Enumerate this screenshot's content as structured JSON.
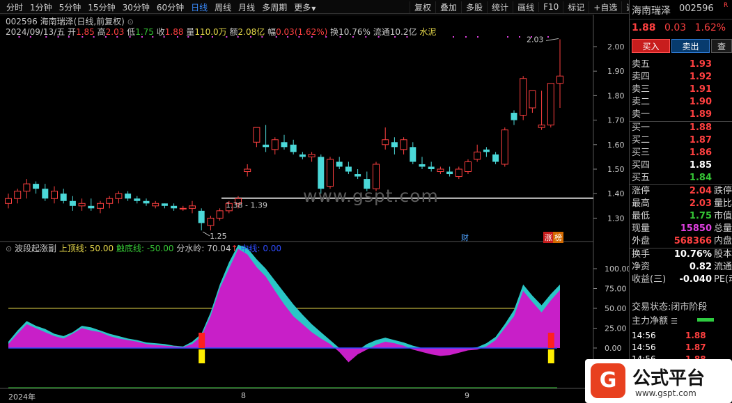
{
  "toolbar": {
    "periods": [
      {
        "label": "分时",
        "active": false
      },
      {
        "label": "1分钟",
        "active": false
      },
      {
        "label": "5分钟",
        "active": false
      },
      {
        "label": "15分钟",
        "active": false
      },
      {
        "label": "30分钟",
        "active": false
      },
      {
        "label": "60分钟",
        "active": false
      },
      {
        "label": "日线",
        "active": true
      },
      {
        "label": "周线",
        "active": false
      },
      {
        "label": "月线",
        "active": false
      },
      {
        "label": "多周期",
        "active": false
      }
    ],
    "more_label": "更多",
    "tools": [
      "复权",
      "叠加",
      "多股",
      "统计",
      "画线",
      "F10",
      "标记",
      "+自选",
      "返回"
    ]
  },
  "chart_header": {
    "code": "002596",
    "name": "海南瑞泽",
    "mode": "(日线,前复权)",
    "date": "2024/09/13/五",
    "open_label": "开",
    "open": "1.85",
    "high_label": "高",
    "high": "2.03",
    "low_label": "低",
    "low": "1.75",
    "close_label": "收",
    "close": "1.88",
    "vol_label": "量",
    "vol": "110.0万",
    "amount_label": "额",
    "amount": "2.08亿",
    "range_label": "幅",
    "range": "0.03(1.62%)",
    "turnover_label": "换",
    "turnover": "10.76%",
    "float_label": "流通",
    "float": "10.2亿",
    "sector": "水泥"
  },
  "annotations": {
    "high_mark": "2.03",
    "low_mark": "1.25",
    "range_mark": "1.38 - 1.39",
    "watermark": "www.gspt.com",
    "badge_cai": "财",
    "badge_zhang": "涨",
    "badge_bang": "榜"
  },
  "indicator": {
    "name": "波段起涨副",
    "top_label": "上顶线:",
    "top_value": "50.00",
    "bottom_label": "触底线:",
    "bottom_value": "-50.00",
    "split_label": "分水岭:",
    "split_value": "70.04",
    "mid_label": "中线:",
    "mid_value": "0.00"
  },
  "x_axis": {
    "year": "2024年",
    "m8": "8",
    "m9": "9"
  },
  "chart_data": [
    {
      "type": "candlestick",
      "title": "002596 海南瑞泽(日线,前复权)",
      "y_ticks": [
        2.0,
        1.9,
        1.8,
        1.7,
        1.6,
        1.5,
        1.4,
        1.3
      ],
      "ylim": [
        1.22,
        2.08
      ],
      "ohlc": [
        [
          1.36,
          1.4,
          1.34,
          1.38
        ],
        [
          1.38,
          1.42,
          1.36,
          1.41
        ],
        [
          1.41,
          1.46,
          1.38,
          1.44
        ],
        [
          1.44,
          1.45,
          1.4,
          1.42
        ],
        [
          1.42,
          1.44,
          1.37,
          1.38
        ],
        [
          1.38,
          1.43,
          1.36,
          1.41
        ],
        [
          1.4,
          1.42,
          1.36,
          1.37
        ],
        [
          1.37,
          1.39,
          1.33,
          1.35
        ],
        [
          1.35,
          1.38,
          1.33,
          1.36
        ],
        [
          1.35,
          1.38,
          1.33,
          1.34
        ],
        [
          1.34,
          1.37,
          1.32,
          1.36
        ],
        [
          1.36,
          1.39,
          1.34,
          1.38
        ],
        [
          1.38,
          1.41,
          1.36,
          1.4
        ],
        [
          1.4,
          1.41,
          1.37,
          1.38
        ],
        [
          1.38,
          1.39,
          1.36,
          1.37
        ],
        [
          1.37,
          1.38,
          1.35,
          1.36
        ],
        [
          1.35,
          1.37,
          1.34,
          1.36
        ],
        [
          1.36,
          1.36,
          1.34,
          1.35
        ],
        [
          1.35,
          1.36,
          1.33,
          1.34
        ],
        [
          1.34,
          1.35,
          1.33,
          1.34
        ],
        [
          1.34,
          1.37,
          1.32,
          1.35
        ],
        [
          1.33,
          1.34,
          1.25,
          1.28
        ],
        [
          1.27,
          1.31,
          1.25,
          1.3
        ],
        [
          1.3,
          1.34,
          1.29,
          1.33
        ],
        [
          1.33,
          1.37,
          1.32,
          1.36
        ],
        [
          1.36,
          1.39,
          1.34,
          1.38
        ],
        [
          1.49,
          1.52,
          1.47,
          1.5
        ],
        [
          1.61,
          1.67,
          1.59,
          1.67
        ],
        [
          1.6,
          1.68,
          1.57,
          1.59
        ],
        [
          1.58,
          1.63,
          1.56,
          1.62
        ],
        [
          1.61,
          1.64,
          1.58,
          1.59
        ],
        [
          1.6,
          1.62,
          1.56,
          1.57
        ],
        [
          1.56,
          1.57,
          1.54,
          1.55
        ],
        [
          1.55,
          1.57,
          1.53,
          1.56
        ],
        [
          1.55,
          1.56,
          1.4,
          1.42
        ],
        [
          1.43,
          1.55,
          1.42,
          1.54
        ],
        [
          1.53,
          1.55,
          1.5,
          1.51
        ],
        [
          1.51,
          1.53,
          1.48,
          1.49
        ],
        [
          1.48,
          1.5,
          1.46,
          1.47
        ],
        [
          1.46,
          1.49,
          1.41,
          1.42
        ],
        [
          1.42,
          1.53,
          1.41,
          1.52
        ],
        [
          1.6,
          1.67,
          1.58,
          1.62
        ],
        [
          1.61,
          1.63,
          1.56,
          1.59
        ],
        [
          1.58,
          1.63,
          1.56,
          1.62
        ],
        [
          1.59,
          1.61,
          1.52,
          1.53
        ],
        [
          1.52,
          1.55,
          1.5,
          1.51
        ],
        [
          1.51,
          1.53,
          1.49,
          1.5
        ],
        [
          1.49,
          1.51,
          1.48,
          1.5
        ],
        [
          1.49,
          1.51,
          1.47,
          1.48
        ],
        [
          1.47,
          1.51,
          1.46,
          1.5
        ],
        [
          1.49,
          1.54,
          1.48,
          1.53
        ],
        [
          1.54,
          1.6,
          1.53,
          1.57
        ],
        [
          1.58,
          1.59,
          1.55,
          1.57
        ],
        [
          1.56,
          1.57,
          1.52,
          1.53
        ],
        [
          1.52,
          1.67,
          1.51,
          1.66
        ],
        [
          1.73,
          1.74,
          1.68,
          1.7
        ],
        [
          1.72,
          1.88,
          1.7,
          1.87
        ],
        [
          1.75,
          1.82,
          1.73,
          1.82
        ],
        [
          1.67,
          1.82,
          1.66,
          1.68
        ],
        [
          1.68,
          1.84,
          1.67,
          1.85
        ],
        [
          1.85,
          2.03,
          1.75,
          1.88
        ]
      ],
      "support_level": 1.39
    },
    {
      "type": "area",
      "title": "波段起涨副",
      "y_ticks": [
        100.0,
        75.0,
        50.0,
        25.0,
        0.0
      ],
      "ylim": [
        -25,
        125
      ],
      "top_line": 50,
      "mid_line": 0,
      "bottom_line": -50,
      "series": [
        {
          "values": [
            5,
            18,
            30,
            25,
            20,
            15,
            12,
            18,
            25,
            22,
            20,
            15,
            12,
            10,
            8,
            5,
            4,
            3,
            2,
            1,
            5,
            15,
            40,
            75,
            100,
            125,
            118,
            102,
            90,
            72,
            55,
            40,
            30,
            20,
            12,
            5,
            -5,
            -18,
            -8,
            -2,
            4,
            8,
            6,
            3,
            -2,
            -5,
            -8,
            -10,
            -9,
            -6,
            -3,
            -2,
            2,
            10,
            25,
            40,
            72,
            58,
            45,
            60,
            73
          ]
        },
        {
          "values": [
            8,
            22,
            34,
            28,
            24,
            18,
            15,
            20,
            28,
            26,
            22,
            18,
            15,
            12,
            10,
            7,
            6,
            5,
            3,
            2,
            8,
            18,
            45,
            80,
            108,
            130,
            126,
            112,
            100,
            85,
            70,
            55,
            42,
            30,
            20,
            10,
            0,
            -12,
            -3,
            5,
            10,
            13,
            10,
            7,
            3,
            0,
            -3,
            -6,
            -4,
            -2,
            0,
            1,
            6,
            14,
            30,
            48,
            80,
            66,
            54,
            68,
            80
          ]
        }
      ],
      "signals": [
        21,
        59
      ]
    }
  ],
  "right_panel": {
    "stock_name": "海南瑞泽",
    "stock_code": "002596",
    "stock_tag": "R",
    "price": "1.88",
    "change": "0.03",
    "pct": "1.62%",
    "buy_btn": "买入",
    "sell_btn": "卖出",
    "query_btn": "查",
    "asks": [
      {
        "label": "卖五",
        "price": "1.93"
      },
      {
        "label": "卖四",
        "price": "1.92"
      },
      {
        "label": "卖三",
        "price": "1.91"
      },
      {
        "label": "卖二",
        "price": "1.90"
      },
      {
        "label": "卖一",
        "price": "1.89"
      }
    ],
    "bids": [
      {
        "label": "买一",
        "price": "1.88",
        "color": "#ff4040"
      },
      {
        "label": "买二",
        "price": "1.87",
        "color": "#ff4040"
      },
      {
        "label": "买三",
        "price": "1.86",
        "color": "#ff4040"
      },
      {
        "label": "买四",
        "price": "1.85",
        "color": "#ffffff"
      },
      {
        "label": "买五",
        "price": "1.84",
        "color": "#35c535"
      }
    ],
    "stats": [
      {
        "label": "涨停",
        "value": "2.04",
        "color": "#ff4040",
        "ext": "跌停"
      },
      {
        "label": "最高",
        "value": "2.03",
        "color": "#ff4040",
        "ext": "量比"
      },
      {
        "label": "最低",
        "value": "1.75",
        "color": "#35c535",
        "ext": "市值"
      },
      {
        "label": "现量",
        "value": "15850",
        "color": "#e040e0",
        "ext": "总量"
      },
      {
        "label": "外盘",
        "value": "568366",
        "color": "#ff4040",
        "ext": "内盘"
      }
    ],
    "stats2": [
      {
        "label": "换手",
        "value": "10.76%",
        "color": "#ffffff",
        "ext": "股本"
      },
      {
        "label": "净资",
        "value": "0.82",
        "color": "#ffffff",
        "ext": "流通"
      },
      {
        "label": "收益(三)",
        "value": "-0.040",
        "color": "#ffffff",
        "ext": "PE(动"
      }
    ],
    "state_label": "交易状态:",
    "state_value": "闭市阶段",
    "flow_label": "主力净额",
    "ticks": [
      {
        "time": "14:56",
        "price": "1.88"
      },
      {
        "time": "14:56",
        "price": "1.87"
      },
      {
        "time": "14:56",
        "price": "1.88"
      }
    ]
  },
  "logo": {
    "text": "公式平台",
    "url": "www.gspt.com"
  }
}
